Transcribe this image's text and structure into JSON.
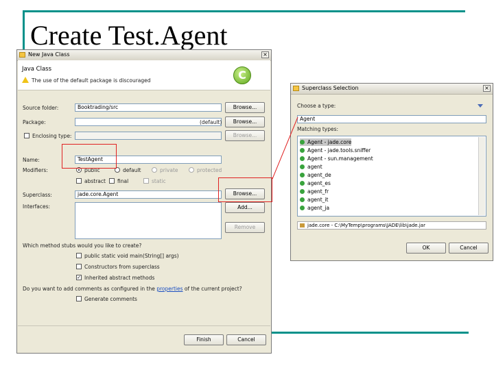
{
  "slide": {
    "title": "Create Test.Agent"
  },
  "new_class": {
    "title": "New Java Class",
    "close": "×",
    "heading": "Java Class",
    "warning": "The use of the default package is discouraged",
    "source_folder_label": "Source folder:",
    "source_folder_value": "Booktrading/src",
    "package_label": "Package:",
    "package_value": "",
    "package_default": "(default)",
    "enclosing_label": "Enclosing type:",
    "enclosing_value": "",
    "browse": "Browse...",
    "name_label": "Name:",
    "name_value": "TestAgent",
    "modifiers_label": "Modifiers:",
    "mod_public": "public",
    "mod_default": "default",
    "mod_private": "private",
    "mod_protected": "protected",
    "mod_abstract": "abstract",
    "mod_final": "final",
    "mod_static": "static",
    "superclass_label": "Superclass:",
    "superclass_value": "jade.core.Agent",
    "interfaces_label": "Interfaces:",
    "add": "Add...",
    "remove": "Remove",
    "stubs_question": "Which method stubs would you like to create?",
    "stub_main": "public static void main(String[] args)",
    "stub_ctor": "Constructors from superclass",
    "stub_inherited": "Inherited abstract methods",
    "comments_q_pre": "Do you want to add comments as configured in the",
    "comments_q_link": "properties",
    "comments_q_post": "of the current project?",
    "generate_comments": "Generate comments",
    "finish": "Finish",
    "cancel": "Cancel"
  },
  "superclass_dialog": {
    "title": "Superclass Selection",
    "close": "×",
    "choose_label": "Choose a type:",
    "filter_value": "Agent",
    "matching_label": "Matching types:",
    "items": [
      "Agent - jade.core",
      "Agent - jade.tools.sniffer",
      "Agent - sun.management",
      "agent",
      "agent_de",
      "agent_es",
      "agent_fr",
      "agent_it",
      "agent_ja"
    ],
    "path": "jade.core - C:\\MyTemp\\programs\\JADE\\lib\\jade.jar",
    "ok": "OK",
    "cancel": "Cancel"
  }
}
